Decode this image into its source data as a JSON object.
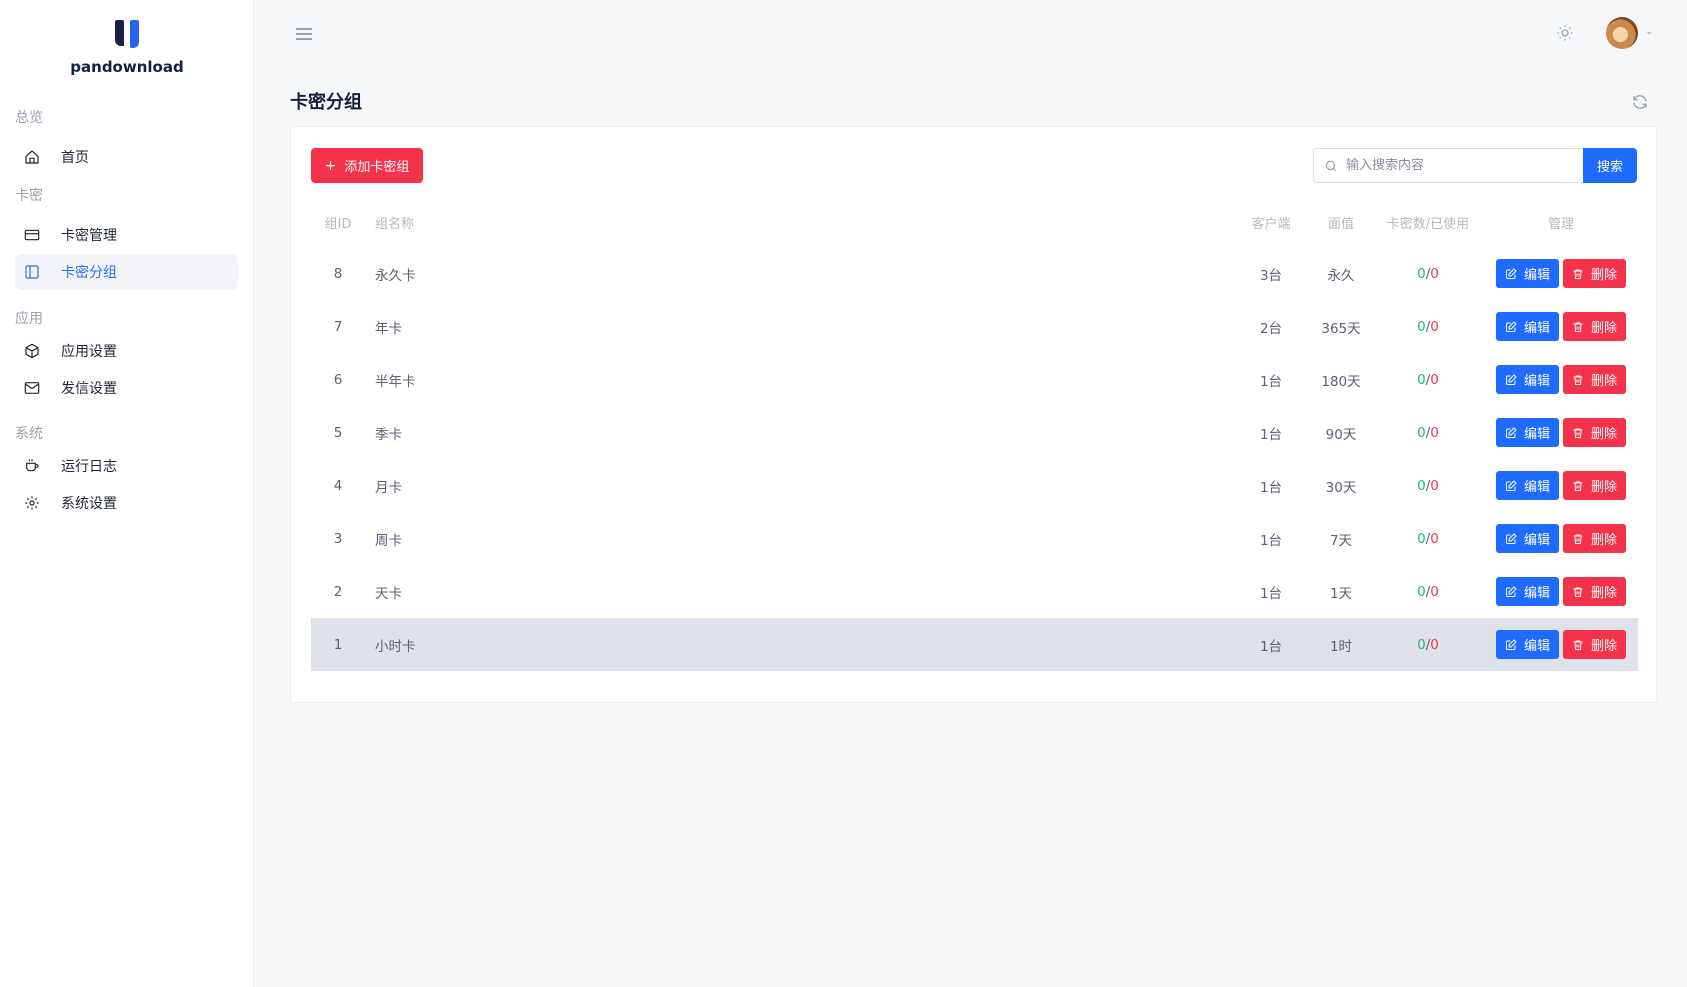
{
  "brand": {
    "name": "pandownload"
  },
  "sidebar": {
    "groups": [
      {
        "label": "总览"
      },
      {
        "label": "卡密"
      },
      {
        "label": "应用"
      },
      {
        "label": "系统"
      }
    ],
    "items": [
      {
        "label": "首页",
        "icon": "home-icon"
      },
      {
        "label": "卡密管理",
        "icon": "card-icon"
      },
      {
        "label": "卡密分组",
        "icon": "sidebar-panel-icon",
        "active": true
      },
      {
        "label": "应用设置",
        "icon": "box-icon"
      },
      {
        "label": "发信设置",
        "icon": "mail-icon"
      },
      {
        "label": "运行日志",
        "icon": "cup-icon"
      },
      {
        "label": "系统设置",
        "icon": "gear-icon"
      }
    ]
  },
  "page": {
    "title": "卡密分组"
  },
  "toolbar": {
    "add_label": "添加卡密组",
    "search_placeholder": "输入搜索内容",
    "search_label": "搜索"
  },
  "table": {
    "headers": {
      "id": "组ID",
      "name": "组名称",
      "client": "客户端",
      "face": "面值",
      "count": "卡密数/已使用",
      "manage": "管理"
    },
    "rows": [
      {
        "id": "8",
        "name": "永久卡",
        "client": "3台",
        "face": "永久",
        "total": "0",
        "used": "0"
      },
      {
        "id": "7",
        "name": "年卡",
        "client": "2台",
        "face": "365天",
        "total": "0",
        "used": "0"
      },
      {
        "id": "6",
        "name": "半年卡",
        "client": "1台",
        "face": "180天",
        "total": "0",
        "used": "0"
      },
      {
        "id": "5",
        "name": "季卡",
        "client": "1台",
        "face": "90天",
        "total": "0",
        "used": "0"
      },
      {
        "id": "4",
        "name": "月卡",
        "client": "1台",
        "face": "30天",
        "total": "0",
        "used": "0"
      },
      {
        "id": "3",
        "name": "周卡",
        "client": "1台",
        "face": "7天",
        "total": "0",
        "used": "0"
      },
      {
        "id": "2",
        "name": "天卡",
        "client": "1台",
        "face": "1天",
        "total": "0",
        "used": "0"
      },
      {
        "id": "1",
        "name": "小时卡",
        "client": "1台",
        "face": "1时",
        "total": "0",
        "used": "0",
        "highlighted": true
      }
    ],
    "edit_label": "编辑",
    "delete_label": "删除",
    "separator": "/"
  },
  "colors": {
    "primary": "#1f6bff",
    "danger": "#f5324b",
    "success": "#22b573",
    "active_nav": "#2d6cf5"
  }
}
